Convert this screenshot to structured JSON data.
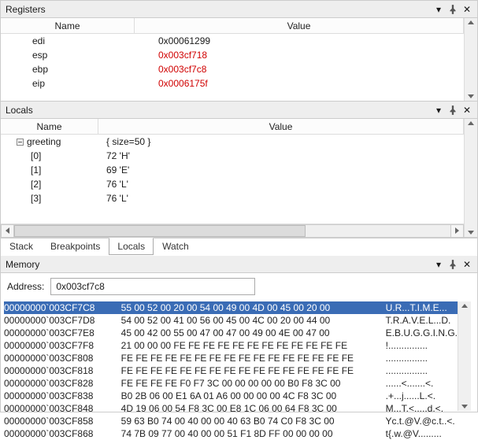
{
  "registersPanel": {
    "title": "Registers",
    "cols": {
      "name": "Name",
      "value": "Value"
    },
    "rows": [
      {
        "n": "edi",
        "v": "0x00061299",
        "red": false
      },
      {
        "n": "esp",
        "v": "0x003cf718",
        "red": true
      },
      {
        "n": "ebp",
        "v": "0x003cf7c8",
        "red": true
      },
      {
        "n": "eip",
        "v": "0x0006175f",
        "red": true
      }
    ]
  },
  "localsPanel": {
    "title": "Locals",
    "cols": {
      "name": "Name",
      "value": "Value"
    },
    "root": {
      "name": "greeting",
      "value": "{ size=50 }"
    },
    "children": [
      {
        "n": "[0]",
        "v": "72 'H'"
      },
      {
        "n": "[1]",
        "v": "69 'E'"
      },
      {
        "n": "[2]",
        "v": "76 'L'"
      },
      {
        "n": "[3]",
        "v": "76 'L'"
      }
    ]
  },
  "tabs": [
    "Stack",
    "Breakpoints",
    "Locals",
    "Watch"
  ],
  "activeTab": "Locals",
  "memoryPanel": {
    "title": "Memory",
    "addressLabel": "Address:",
    "addressValue": "0x003cf7c8",
    "rows": [
      {
        "a": "00000000`003CF7C8",
        "h": "55 00 52 00 20 00 54 00 49 00 4D 00 45 00 20 00",
        "s": "U.R...T.I.M.E...",
        "sel": true
      },
      {
        "a": "00000000`003CF7D8",
        "h": "54 00 52 00 41 00 56 00 45 00 4C 00 20 00 44 00",
        "s": "T.R.A.V.E.L...D."
      },
      {
        "a": "00000000`003CF7E8",
        "h": "45 00 42 00 55 00 47 00 47 00 49 00 4E 00 47 00",
        "s": "E.B.U.G.G.I.N.G."
      },
      {
        "a": "00000000`003CF7F8",
        "h": "21 00 00 00 FE FE FE FE FE FE FE FE FE FE FE FE",
        "s": "!..............."
      },
      {
        "a": "00000000`003CF808",
        "h": "FE FE FE FE FE FE FE FE FE FE FE FE FE FE FE FE",
        "s": "................"
      },
      {
        "a": "00000000`003CF818",
        "h": "FE FE FE FE FE FE FE FE FE FE FE FE FE FE FE FE",
        "s": "................"
      },
      {
        "a": "00000000`003CF828",
        "h": "FE FE FE FE F0 F7 3C 00 00 00 00 00 B0 F8 3C 00",
        "s": "......<.......<."
      },
      {
        "a": "00000000`003CF838",
        "h": "B0 2B 06 00 E1 6A 01 A6 00 00 00 00 4C F8 3C 00",
        "s": ".+...j......L.<."
      },
      {
        "a": "00000000`003CF848",
        "h": "4D 19 06 00 54 F8 3C 00 E8 1C 06 00 64 F8 3C 00",
        "s": "M...T.<.....d.<."
      },
      {
        "a": "00000000`003CF858",
        "h": "59 63 B0 74 00 40 00 00 40 63 B0 74 C0 F8 3C 00",
        "s": "Yc.t.@V.@c.t..<."
      },
      {
        "a": "00000000`003CF868",
        "h": "74 7B 09 77 00 40 00 00 51 F1 8D FF 00 00 00 00",
        "s": "t{.w.@V........."
      }
    ]
  }
}
